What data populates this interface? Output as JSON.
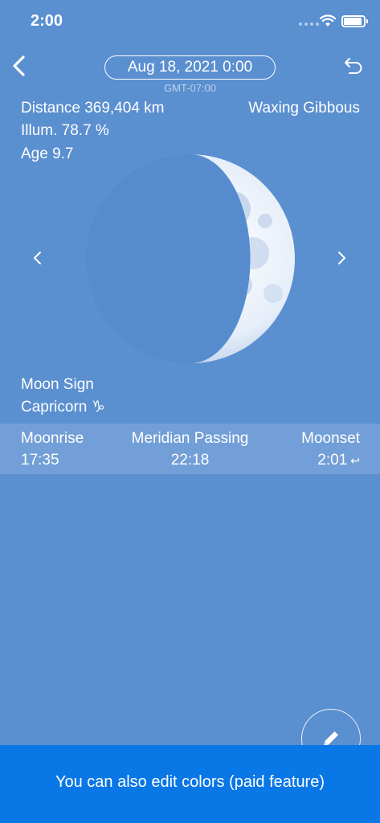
{
  "status_bar": {
    "time": "2:00"
  },
  "header": {
    "date": "Aug 18, 2021 0:00",
    "timezone": "GMT-07:00"
  },
  "moon_info": {
    "distance": "Distance 369,404 km",
    "illumination": "Illum. 78.7 %",
    "age": "Age 9.7",
    "phase": "Waxing Gibbous",
    "illumination_fraction": 0.787
  },
  "moon_sign": {
    "label": "Moon Sign",
    "value": "Capricorn ♑︎"
  },
  "rise_set": {
    "moonrise_label": "Moonrise",
    "moonrise_time": "17:35",
    "meridian_label": "Meridian Passing",
    "meridian_time": "22:18",
    "moonset_label": "Moonset",
    "moonset_time": "2:01",
    "next_day_symbol": "↩"
  },
  "banner": {
    "text": "You can also edit colors (paid feature)"
  },
  "colors": {
    "background": "#5a8fd0",
    "banner": "#0a77e6",
    "text": "#ffffff"
  },
  "icons": {
    "back": "chevron-left-icon",
    "undo": "undo-arrow-icon",
    "prev": "chevron-left-icon",
    "next": "chevron-right-icon",
    "edit": "pencil-icon",
    "wifi": "wifi-icon",
    "battery": "battery-icon"
  }
}
